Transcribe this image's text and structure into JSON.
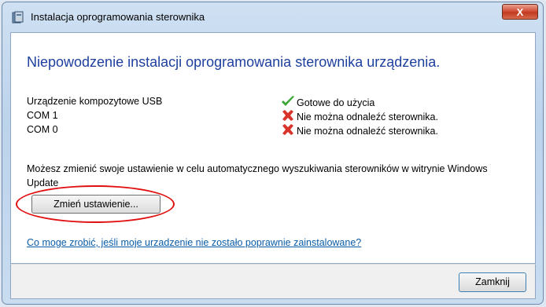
{
  "window": {
    "title": "Instalacja oprogramowania sterownika",
    "close_glyph": "X",
    "title_icon": "driver-install-icon"
  },
  "content": {
    "heading": "Niepowodzenie instalacji oprogramowania sterownika urządzenia.",
    "devices": [
      {
        "name": "Urządzenie kompozytowe USB",
        "status": "Gotowe do użycia",
        "status_icon": "check-icon",
        "status_color": "#3aa635"
      },
      {
        "name": "COM 1",
        "status": "Nie można odnaleźć sterownika.",
        "status_icon": "error-x-icon",
        "status_color": "#d9342b"
      },
      {
        "name": "COM 0",
        "status": "Nie można odnaleźć sterownika.",
        "status_icon": "error-x-icon",
        "status_color": "#d9342b"
      }
    ],
    "info_text": "Możesz zmienić swoje ustawienie w celu automatycznego wyszukiwania sterowników w witrynie Windows Update",
    "change_button": "Zmień ustawienie...",
    "help_link": "Co moge zrobić, jeśli moje urzadzenie nie zostało poprawnie zainstalowane?"
  },
  "footer": {
    "close_button": "Zamknij"
  },
  "colors": {
    "heading": "#1e3f9e",
    "link": "#0a5ca8",
    "annotation": "#e01010"
  }
}
